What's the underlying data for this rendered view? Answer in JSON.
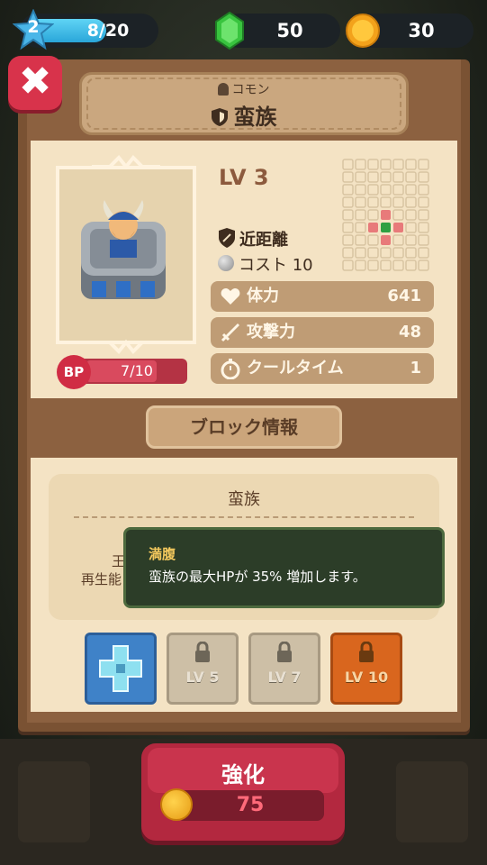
{
  "top_bar": {
    "level": "2",
    "xp_text": "8/20",
    "xp_progress": 0.4,
    "gems": "50",
    "coins": "30"
  },
  "header": {
    "rarity_label": "コモン",
    "unit_name": "蛮族"
  },
  "unit": {
    "level_label": "LV 3",
    "range_label": "近距離",
    "cost_label": "コスト 10",
    "bp_text": "7/10",
    "bp_badge": "BP",
    "bp_progress": 0.7,
    "stats": [
      {
        "label": "体力",
        "value": "641",
        "icon": "heart-icon"
      },
      {
        "label": "攻撃力",
        "value": "48",
        "icon": "sword-icon"
      },
      {
        "label": "クールタイム",
        "value": "1",
        "icon": "stopwatch-icon"
      }
    ]
  },
  "block_info": {
    "tab_label": "ブロック情報",
    "block_name": "蛮族",
    "partial_line1": "王",
    "partial_line2": "再生能",
    "tooltip": {
      "title": "満腹",
      "text": "蛮族の最大HPが 35% 増加します。"
    },
    "skills": [
      {
        "label": "",
        "state": "unlocked",
        "icon": "plus-cross-icon"
      },
      {
        "label": "LV 5",
        "state": "locked",
        "icon": "lock-icon"
      },
      {
        "label": "LV 7",
        "state": "locked",
        "icon": "lock-icon"
      },
      {
        "label": "LV 10",
        "state": "locked",
        "icon": "lock-icon"
      }
    ]
  },
  "upgrade": {
    "label": "強化",
    "price": "75"
  },
  "colors": {
    "close_red": "#d8334b",
    "panel_brown": "#7a5233",
    "card_cream": "#f4e3c4",
    "accent_green": "#2ea043",
    "tooltip_bg": "#2c3d28"
  }
}
